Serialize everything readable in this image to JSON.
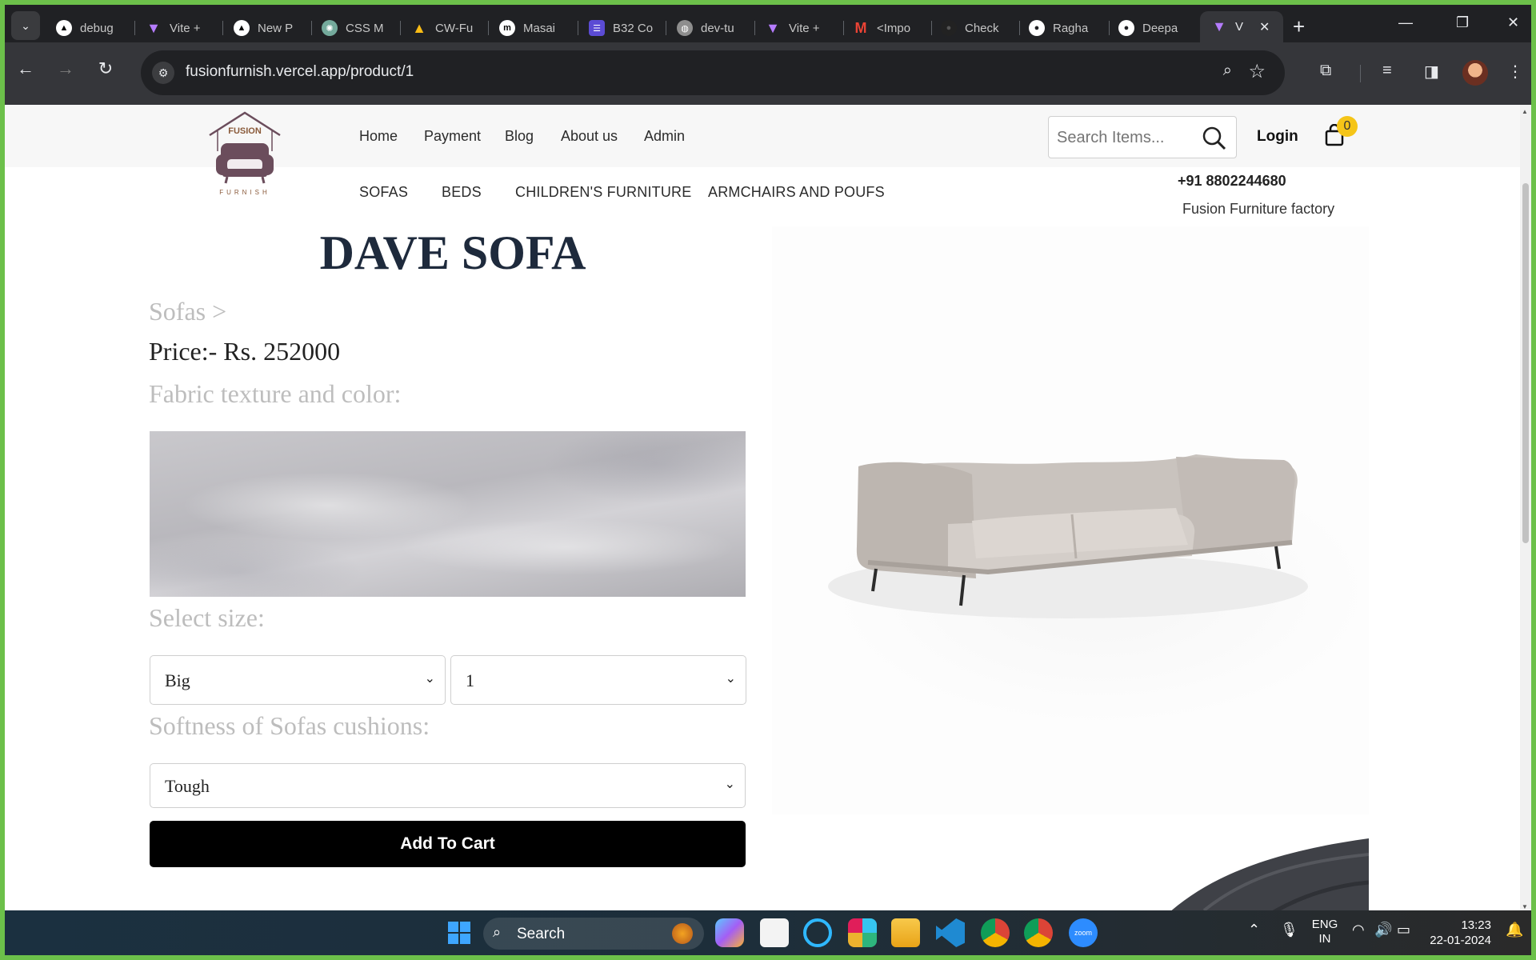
{
  "browser": {
    "tabs": [
      {
        "label": "debug",
        "icon": "triangle-icon",
        "color": "#000000"
      },
      {
        "label": "Vite +",
        "icon": "vite-icon",
        "color": "#9a5cff"
      },
      {
        "label": "New P",
        "icon": "triangle-icon",
        "color": "#000000"
      },
      {
        "label": "CSS M",
        "icon": "openai-icon",
        "color": "#74aa9c"
      },
      {
        "label": "CW-Fu",
        "icon": "drive-icon",
        "color": "#1fa463"
      },
      {
        "label": "Masai",
        "icon": "masai-icon",
        "color": "#000000"
      },
      {
        "label": "B32 Co",
        "icon": "list-icon",
        "color": "#5b4bd4"
      },
      {
        "label": "dev-tu",
        "icon": "globe-icon",
        "color": "#8e8e8e"
      },
      {
        "label": "Vite +",
        "icon": "vite-icon",
        "color": "#9a5cff"
      },
      {
        "label": "<Impo",
        "icon": "gmail-icon",
        "color": "#ea4335"
      },
      {
        "label": "Check",
        "icon": "github-icon",
        "color": "#222222"
      },
      {
        "label": "Ragha",
        "icon": "github-icon",
        "color": "#ffffff"
      },
      {
        "label": "Deepa",
        "icon": "github-icon",
        "color": "#ffffff"
      }
    ],
    "active_tab": {
      "label": "V",
      "icon": "vite-icon"
    },
    "url": "fusionfurnish.vercel.app/product/1"
  },
  "site": {
    "logo_text": "FUSION",
    "logo_subtext": "FURNISH",
    "nav": [
      "Home",
      "Payment",
      "Blog",
      "About us",
      "Admin"
    ],
    "categories": [
      "SOFAS",
      "BEDS",
      "CHILDREN'S FURNITURE",
      "ARMCHAIRS AND POUFS"
    ],
    "search_placeholder": "Search Items...",
    "login_label": "Login",
    "cart_count": "0",
    "phone": "+91 8802244680",
    "factory": "Fusion Furniture factory"
  },
  "product": {
    "title": "DAVE SOFA",
    "breadcrumb": "Sofas >",
    "price": "Price:- Rs. 252000",
    "fabric_label": "Fabric texture and color:",
    "size_label": "Select size:",
    "size_value": "Big",
    "quantity_value": "1",
    "softness_label": "Softness of Sofas cushions:",
    "softness_value": "Tough",
    "add_to_cart_label": "Add To Cart"
  },
  "taskbar": {
    "search_label": "Search",
    "lang_line1": "ENG",
    "lang_line2": "IN",
    "time": "13:23",
    "date": "22-01-2024"
  },
  "colors": {
    "title": "#1e2a3c",
    "muted_label": "#bdbdbd",
    "cart_badge": "#f5c518",
    "button": "#000000"
  }
}
